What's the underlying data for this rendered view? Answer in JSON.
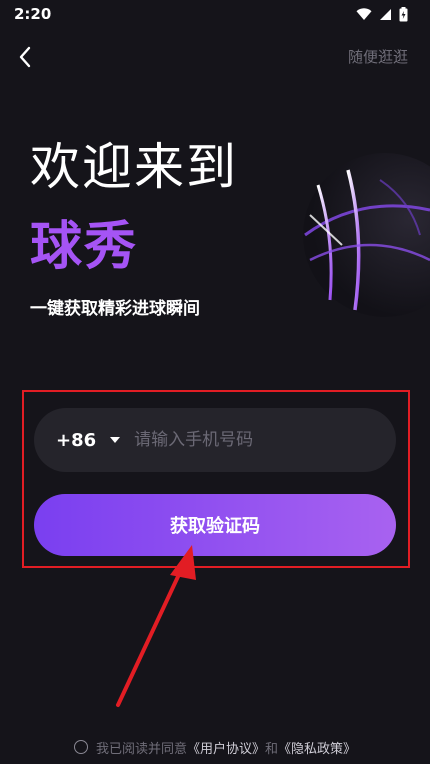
{
  "status_bar": {
    "time": "2:20"
  },
  "header": {
    "back_icon": "chevron-left-icon",
    "skip_label": "随便逛逛"
  },
  "hero": {
    "welcome": "欢迎来到",
    "brand": "球秀",
    "tagline": "一键获取精彩进球瞬间",
    "brand_color": "#a554f5"
  },
  "form": {
    "country_code": "+86",
    "phone_placeholder": "请输入手机号码",
    "phone_value": "",
    "get_code_label": "获取验证码",
    "button_gradient": [
      "#7a3ff0",
      "#a862f0"
    ]
  },
  "agreement": {
    "prefix": "我已阅读并同意",
    "user_agreement": "《用户协议》",
    "conjunction": "和",
    "privacy_policy": "《隐私政策》"
  },
  "annotation": {
    "highlight_color": "#e21d24"
  }
}
